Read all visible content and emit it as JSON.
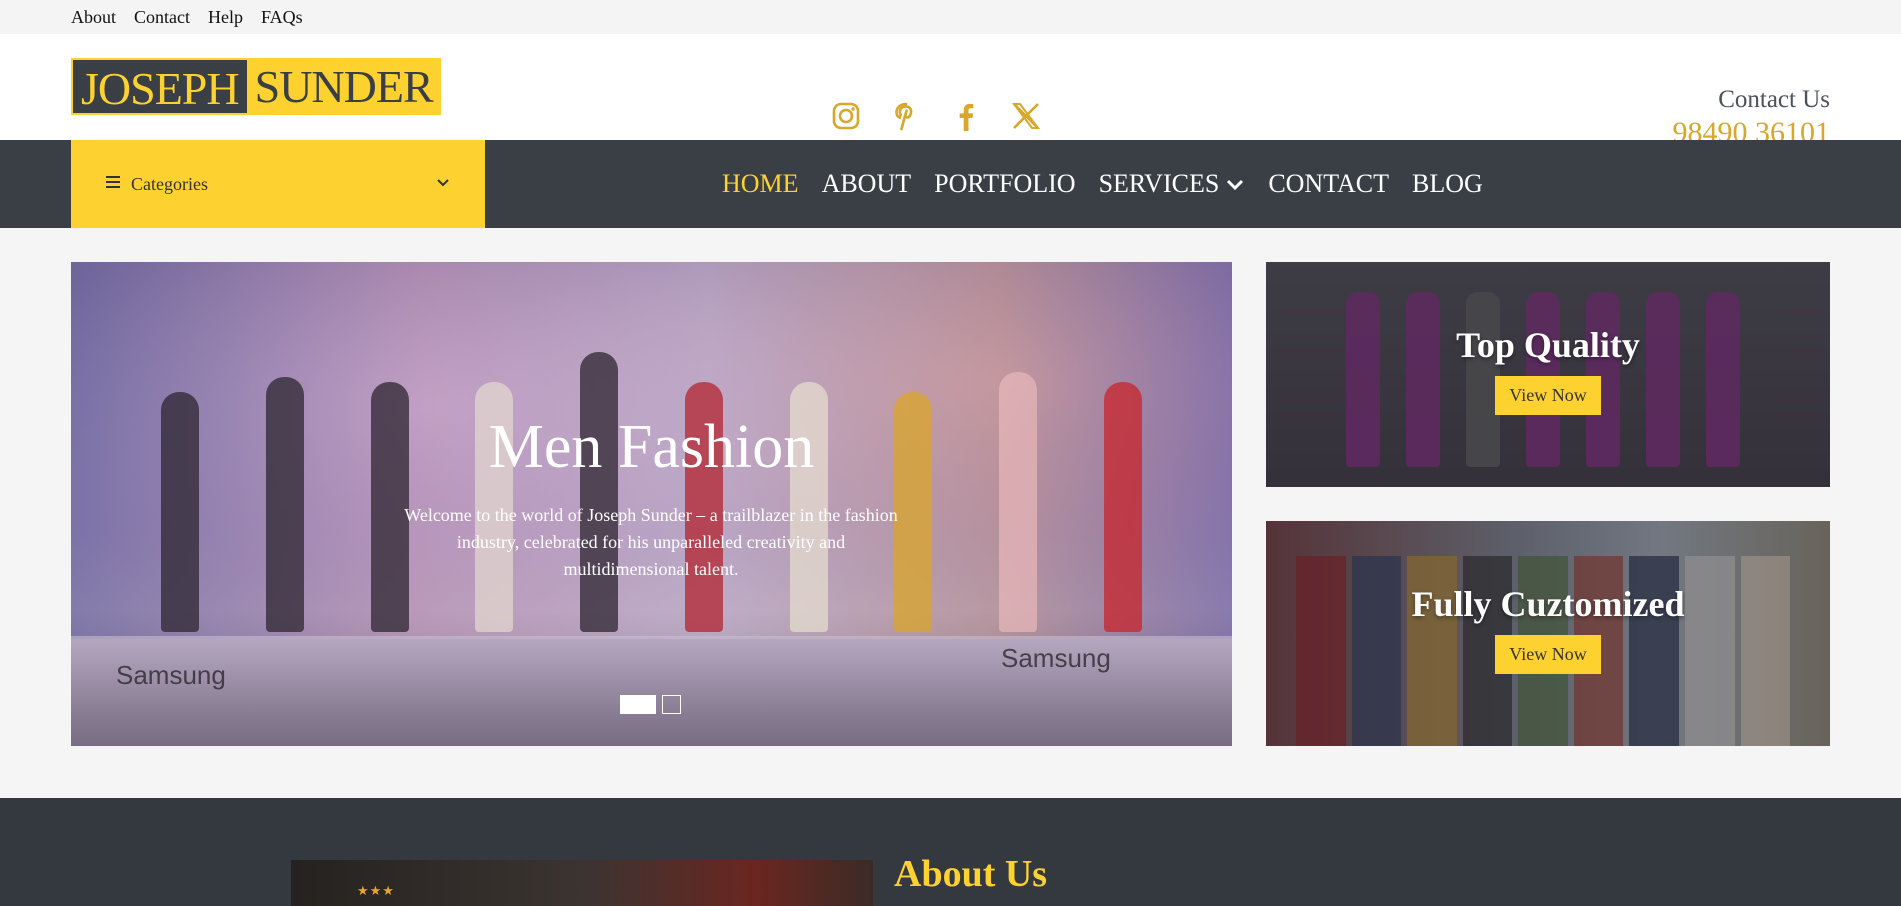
{
  "topbar": {
    "links": [
      "About",
      "Contact",
      "Help",
      "FAQs"
    ]
  },
  "header": {
    "logo": {
      "part1": "JOSEPH",
      "part2": "SUNDER"
    },
    "social": [
      "instagram-icon",
      "pinterest-icon",
      "facebook-icon",
      "x-icon"
    ],
    "contact": {
      "title": "Contact Us",
      "phone": "98490 36101"
    }
  },
  "nav": {
    "categories_label": "Categories",
    "menu": [
      "HOME",
      "ABOUT",
      "PORTFOLIO",
      "SERVICES",
      "CONTACT",
      "BLOG"
    ],
    "active": "HOME"
  },
  "hero": {
    "title": "Men Fashion",
    "description": "Welcome to the world of Joseph Sunder – a trailblazer in the fashion industry, celebrated for his unparalleled creativity and multidimensional talent.",
    "brand_left": "Samsung",
    "brand_right": "Samsung",
    "slides": 2,
    "active_slide": 1
  },
  "cards": [
    {
      "title": "Top Quality",
      "button": "View Now"
    },
    {
      "title": "Fully Cuztomized",
      "button": "View Now"
    }
  ],
  "about": {
    "heading": "About Us"
  },
  "colors": {
    "accent": "#fdd12f",
    "dark": "#3a3f46",
    "gold": "#d8a72b"
  }
}
